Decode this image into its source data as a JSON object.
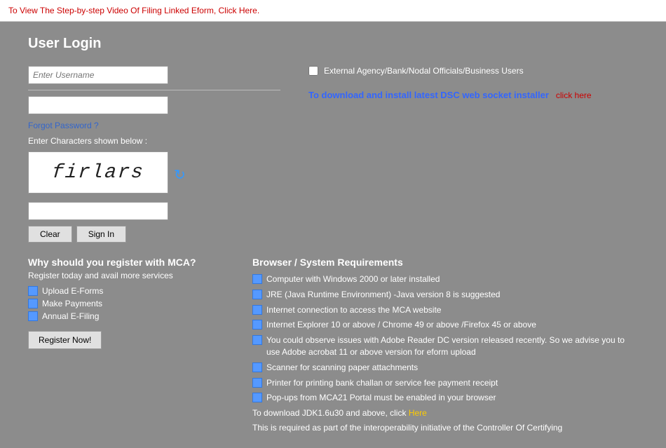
{
  "topbar": {
    "notice_text": "To View The Step-by-step Video Of Filing Linked Eform,",
    "click_text": "Click Here."
  },
  "login": {
    "title": "User Login",
    "username_placeholder": "Enter Username",
    "forgot_password": "Forgot Password ?",
    "captcha_label": "Enter Characters shown below :",
    "captcha_value": "firlars",
    "external_label": "External Agency/Bank/Nodal Officials/Business Users",
    "dsc_text": "To download and install latest DSC web socket installer",
    "dsc_link": "click here",
    "clear_btn": "Clear",
    "signin_btn": "Sign In"
  },
  "register": {
    "title": "Why should you register with MCA?",
    "subtitle": "Register today and avail more services",
    "items": [
      "Upload E-Forms",
      "Make Payments",
      "Annual E-Filing"
    ],
    "register_btn": "Register Now!"
  },
  "browser": {
    "title": "Browser / System Requirements",
    "items": [
      "Computer with Windows 2000 or later installed",
      "JRE (Java Runtime Environment) -Java version 8 is suggested",
      "Internet connection to access the MCA website",
      "Internet Explorer 10 or above / Chrome 49 or above /Firefox 45 or above",
      "You could observe issues with Adobe Reader DC version released recently. So we advise you to use Adobe acrobat 11 or above version for eform upload",
      "Scanner for scanning paper attachments",
      "Printer for printing bank challan or service fee payment receipt",
      "Pop-ups from MCA21 Portal must be enabled in your browser"
    ],
    "note1": "To download JDK1.6u30 and above, click",
    "note1_link": "Here",
    "note2": "This is required as part of the interoperability initiative of the Controller Of Certifying"
  }
}
